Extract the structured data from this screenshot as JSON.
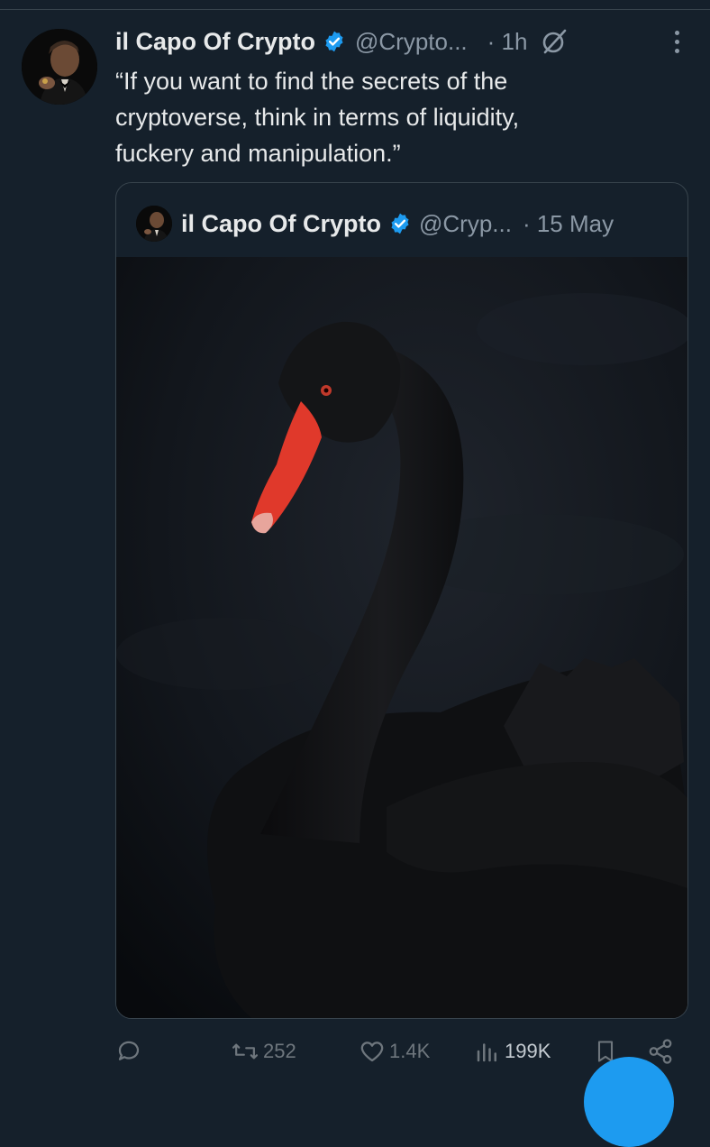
{
  "tweet": {
    "author_name": "il Capo Of Crypto",
    "handle": "@Crypto...",
    "time": "· 1h",
    "text_lines": [
      "“If you want to find the secrets of the",
      "cryptoverse, think in terms of liquidity,",
      "fuckery and manipulation.”"
    ]
  },
  "quote": {
    "author_name": "il Capo Of Crypto",
    "handle": "@Cryp...",
    "time": "· 15 May"
  },
  "actions": {
    "reply_count": "",
    "retweet_count": "252",
    "like_count": "1.4K",
    "views_count": "199K"
  },
  "colors": {
    "background": "#15202b",
    "accent": "#1d9bf0",
    "muted": "#8b98a5",
    "beak": "#e0392b"
  },
  "icons": [
    "verified-badge-icon",
    "grok-icon",
    "more-icon",
    "reply-icon",
    "retweet-icon",
    "like-icon",
    "views-icon",
    "bookmark-icon",
    "share-icon"
  ]
}
